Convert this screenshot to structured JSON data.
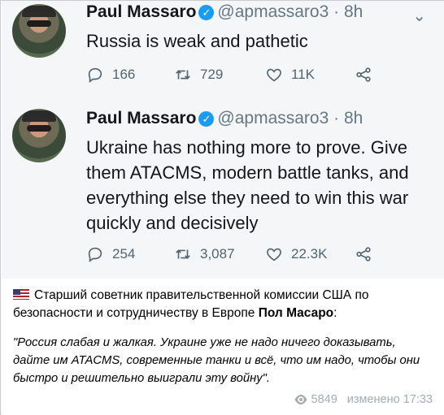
{
  "tweets": [
    {
      "name": "Paul Massaro",
      "handle": "@apmassaro3 · 8h",
      "text": "Russia is weak and pathetic",
      "replies": "166",
      "retweets": "729",
      "likes": "11K"
    },
    {
      "name": "Paul Massaro",
      "handle": "@apmassaro3 · 8h",
      "text": "Ukraine has nothing more to prove. Give them ATACMS, modern battle tanks, and everything else they need to win this war quickly and decisively",
      "replies": "254",
      "retweets": "3,087",
      "likes": "22.3K"
    }
  ],
  "caption": {
    "flag_icon": "us-flag-icon",
    "intro": "Старший советник правительственной комиссии США по безопасности и сотрудничеству в Европе ",
    "name_bold": "Пол Масаро",
    "intro_end": ":",
    "quote": "\"Россия слабая и жалкая. Украине уже не надо ничего доказывать, дайте им ATACMS, современные танки и всё, что им надо, чтобы они быстро и решительно выиграли эту войну\"."
  },
  "meta": {
    "views": "5849",
    "edited": "изменено",
    "time": "17:33"
  },
  "colors": {
    "verified": "#1d9bf0",
    "tweet_bg": "#f4f6f8",
    "meta": "#a3acb5"
  }
}
